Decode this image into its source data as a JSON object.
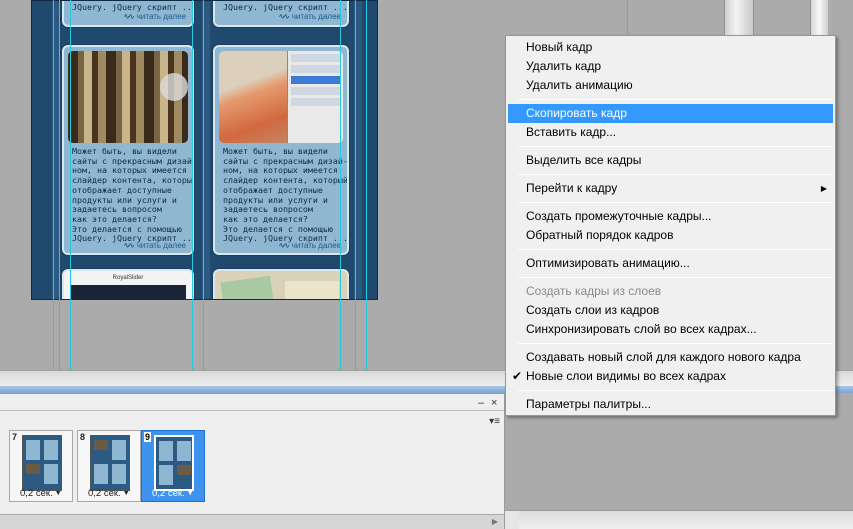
{
  "canvas": {
    "tile_text": "Может быть, вы видели\nсайты с прекрасным дизай-\nном, на которых имеется\nслайдер контента, который\nотображает доступные\nпродукты или услуги и\nзадаетесь вопросом\nкак это делается?\nЭто делается с помощью\nJQuery. jQuery скрипт ........",
    "top_tile_text": "JQuery. jQuery скрипт ........",
    "read_more": "читать далее",
    "royal_slider_label": "RoyalSlider"
  },
  "animation_panel": {
    "minimize": "–",
    "close": "×",
    "panel_menu": "▾≡",
    "frames": [
      {
        "number": "7",
        "delay": "0,2 сек.",
        "selected": false
      },
      {
        "number": "8",
        "delay": "0,2 сек.",
        "selected": false
      },
      {
        "number": "9",
        "delay": "0,2 сек.",
        "selected": true
      }
    ],
    "delay_arrow": "▼",
    "scroll_arrow": "▶"
  },
  "context_menu": {
    "items": [
      {
        "label": "Новый кадр",
        "state": "normal"
      },
      {
        "label": "Удалить кадр",
        "state": "normal"
      },
      {
        "label": "Удалить анимацию",
        "state": "normal"
      },
      {
        "label": "Скопировать кадр",
        "state": "highlighted"
      },
      {
        "label": "Вставить кадр...",
        "state": "normal"
      },
      {
        "label": "Выделить все кадры",
        "state": "normal"
      },
      {
        "label": "Перейти к кадру",
        "state": "submenu"
      },
      {
        "label": "Создать промежуточные кадры...",
        "state": "normal"
      },
      {
        "label": "Обратный порядок кадров",
        "state": "normal"
      },
      {
        "label": "Оптимизировать анимацию...",
        "state": "normal"
      },
      {
        "label": "Создать кадры из слоев",
        "state": "disabled"
      },
      {
        "label": "Создать слои из кадров",
        "state": "normal"
      },
      {
        "label": "Синхронизировать слой во всех кадрах...",
        "state": "normal"
      },
      {
        "label": "Создавать новый слой для каждого нового кадра",
        "state": "normal"
      },
      {
        "label": "Новые слои видимы во всех кадрах",
        "state": "checked"
      },
      {
        "label": "Параметры палитры...",
        "state": "normal"
      }
    ],
    "submenu_arrow": "▶",
    "check_mark": "✔"
  },
  "colors": {
    "menu_highlight": "#3399ff",
    "selected_frame": "#3d93ee",
    "canvas_bg": "#1f4a6e"
  }
}
